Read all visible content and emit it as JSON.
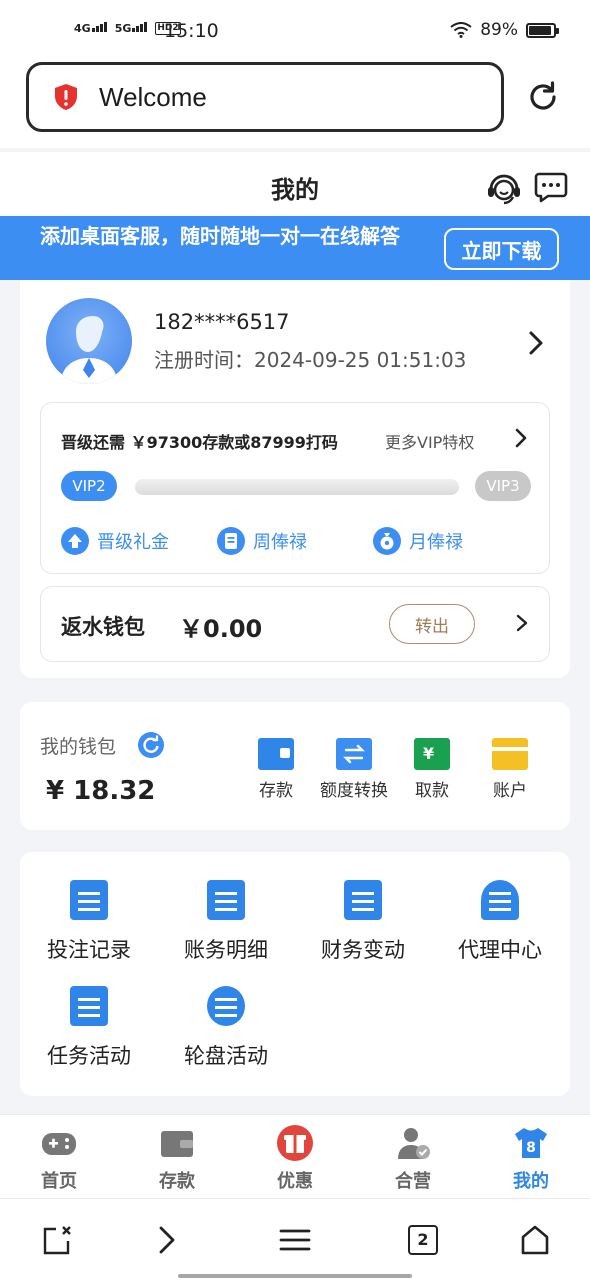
{
  "status_bar": {
    "net1": "4G",
    "net2": "5G",
    "hd": "HD2",
    "time": "15:10",
    "battery": "89%"
  },
  "browser": {
    "url_text": "Welcome",
    "tab_count": "2"
  },
  "header": {
    "title": "我的"
  },
  "banner": {
    "text": "添加桌面客服，随时随地一对一在线解答",
    "button": "立即下载"
  },
  "profile": {
    "phone": "182****6517",
    "reg_time": "注册时间：2024-09-25 01:51:03"
  },
  "vip": {
    "need_text": "晋级还需 ￥97300存款或87999打码",
    "more": "更多VIP特权",
    "current": "VIP2",
    "next": "VIP3",
    "progress": 0,
    "perks": [
      "晋级礼金",
      "周俸禄",
      "月俸禄"
    ]
  },
  "rebate": {
    "label": "返水钱包",
    "amount": "￥0.00",
    "button": "转出"
  },
  "wallet": {
    "label": "我的钱包",
    "amount": "¥ 18.32",
    "actions": [
      "存款",
      "额度转换",
      "取款",
      "账户"
    ]
  },
  "functions": [
    "投注记录",
    "账务明细",
    "财务变动",
    "代理中心",
    "任务活动",
    "轮盘活动"
  ],
  "tabs": [
    "首页",
    "存款",
    "优惠",
    "合营",
    "我的"
  ],
  "active_tab_badge": "8",
  "colors": {
    "accent": "#3d8ef2",
    "icon_blue": "#2f86e8",
    "rebate_button": "#b58a66",
    "promo_red": "#e2453b",
    "wallet_green": "#1aa14f",
    "wallet_yellow": "#f5c024"
  }
}
